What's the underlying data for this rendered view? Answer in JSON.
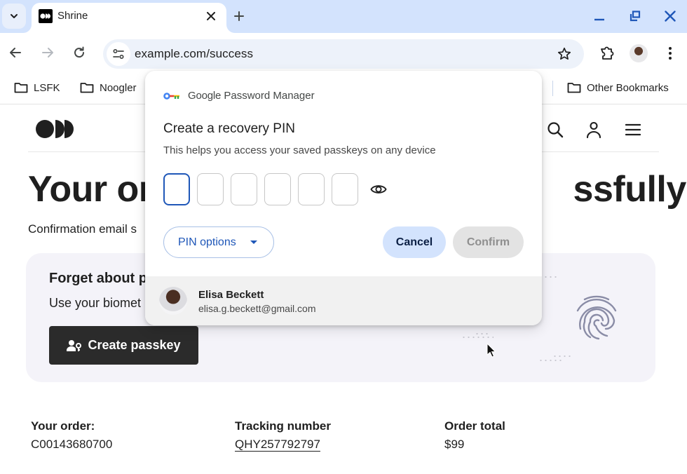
{
  "browser": {
    "tab": {
      "title": "Shrine"
    },
    "url": "example.com/success",
    "bookmarks": [
      {
        "label": "LSFK"
      },
      {
        "label": "Noogler"
      }
    ],
    "other_bookmarks": "Other Bookmarks",
    "icons": {
      "tab_search": "chevron-down-icon",
      "tab_close": "close-icon",
      "new_tab": "plus-icon",
      "minimize": "minimize-icon",
      "restore": "restore-icon",
      "close_window": "close-icon",
      "back": "arrow-left-icon",
      "forward": "arrow-right-icon",
      "reload": "reload-icon",
      "site_info": "tune-icon",
      "bookmark_star": "star-icon",
      "extensions": "puzzle-icon",
      "menu": "more-vert-icon"
    },
    "accent_color": "#d3e3fd"
  },
  "site": {
    "headline_left": "Your or",
    "headline_right": "ssfully",
    "confirmation_text": "Confirmation email s",
    "nav_icons": [
      "search-icon",
      "account-icon",
      "menu-icon"
    ],
    "passkey_card": {
      "title": "Forget about p",
      "subtitle": "Use your biomet",
      "button_label": "Create passkey"
    },
    "order": {
      "order_label": "Your order:",
      "order_value": "C00143680700",
      "tracking_label": "Tracking number",
      "tracking_value": "QHY257792797",
      "total_label": "Order total",
      "total_value": "$99"
    }
  },
  "password_manager": {
    "brand_google": "Google",
    "brand_product": "Password Manager",
    "title": "Create a recovery PIN",
    "subtitle": "This helps you access your saved passkeys on any device",
    "pin_length": 6,
    "pin_digits": [
      "",
      "",
      "",
      "",
      "",
      ""
    ],
    "pin_options_label": "PIN options",
    "cancel_label": "Cancel",
    "confirm_label": "Confirm",
    "confirm_enabled": false,
    "account": {
      "name": "Elisa Beckett",
      "email": "elisa.g.beckett@gmail.com"
    },
    "primary_color": "#1f57b8",
    "cancel_bg": "#d3e3fd"
  }
}
